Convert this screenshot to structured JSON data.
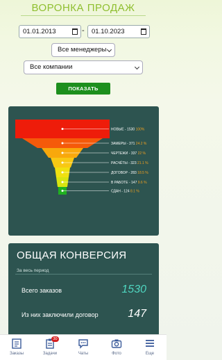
{
  "title": "ВОРОНКА ПРОДАЖ",
  "filters": {
    "date_from": "01.01.2013",
    "date_to": "01.10.2023",
    "separator": "-",
    "managers": "Все менеджеры",
    "companies": "Все компании",
    "show_button": "ПОКАЗАТЬ"
  },
  "chart_data": {
    "type": "funnel",
    "stages": [
      {
        "label": "НОВЫЕ - 1530",
        "value": 1530,
        "percent": "100%",
        "color": "#ee1c0a"
      },
      {
        "label": "ЗАМЕРЫ - 371",
        "value": 371,
        "percent": "24.2 %",
        "color": "#f55a0a"
      },
      {
        "label": "ЧЕРТЕЖИ - 337",
        "value": 337,
        "percent": "22 %",
        "color": "#f8a80c"
      },
      {
        "label": "РАСЧЁТЫ - 323",
        "value": 323,
        "percent": "21.1 %",
        "color": "#f8c814"
      },
      {
        "label": "ДОГОВОР - 283",
        "value": 283,
        "percent": "18.5 %",
        "color": "#f0e010"
      },
      {
        "label": "В РАБОТЕ - 147",
        "value": 147,
        "percent": "9.6 %",
        "color": "#d8e410"
      },
      {
        "label": "СДАН - 124",
        "value": 124,
        "percent": "8.1 %",
        "color": "#20b020"
      }
    ]
  },
  "conversion": {
    "title": "ОБЩАЯ КОНВЕРСИЯ",
    "period": "За весь период",
    "rows": [
      {
        "label": "Всего заказов",
        "value": "1530",
        "color": "#4fd6c0"
      },
      {
        "label": "Из них заключили договор",
        "value": "147",
        "color": "#ffffff"
      }
    ]
  },
  "nav": {
    "items": [
      {
        "label": "Заказы",
        "icon": "orders-icon"
      },
      {
        "label": "Задачи",
        "icon": "tasks-icon",
        "badge": "30"
      },
      {
        "label": "Чаты",
        "icon": "chat-icon"
      },
      {
        "label": "Фото",
        "icon": "camera-icon"
      },
      {
        "label": "Еще",
        "icon": "menu-icon"
      }
    ]
  }
}
